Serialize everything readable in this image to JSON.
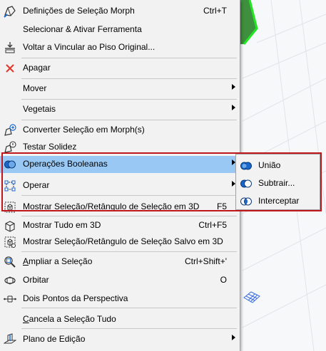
{
  "menu": {
    "items": [
      {
        "label": "Definições de Seleção Morph",
        "shortcut": "Ctrl+T",
        "icon": "morph-settings-icon"
      },
      {
        "label": "Selecionar & Ativar Ferramenta",
        "shortcut": "",
        "icon": ""
      },
      {
        "label": "Voltar a Vincular ao Piso Original...",
        "shortcut": "",
        "icon": "relink-floor-icon"
      },
      {
        "label": "Apagar",
        "shortcut": "",
        "icon": "delete-icon"
      },
      {
        "label": "Mover",
        "shortcut": "",
        "icon": ""
      },
      {
        "label": "Vegetais",
        "shortcut": "",
        "icon": ""
      },
      {
        "label": "Converter Seleção em Morph(s)",
        "shortcut": "",
        "icon": "convert-morph-icon"
      },
      {
        "label": "Testar Solidez",
        "shortcut": "",
        "icon": "test-solidity-icon"
      },
      {
        "label": "Operações Booleanas",
        "shortcut": "",
        "icon": "boolean-icon"
      },
      {
        "label": "Operar",
        "shortcut": "",
        "icon": "operate-icon"
      },
      {
        "label": "Mostrar Seleção/Retângulo de Seleção em 3D",
        "shortcut": "F5",
        "icon": "show-selection-3d-icon"
      },
      {
        "label": "Mostrar Tudo em 3D",
        "shortcut": "Ctrl+F5",
        "icon": "show-all-3d-icon"
      },
      {
        "label": "Mostrar Seleção/Retângulo de Seleção Salvo em 3D",
        "shortcut": "",
        "icon": "show-saved-selection-3d-icon"
      },
      {
        "label": "Ampliar a Seleção",
        "shortcut": "Ctrl+Shift+'",
        "icon": "zoom-selection-icon"
      },
      {
        "label": "Orbitar",
        "shortcut": "O",
        "icon": "orbit-icon"
      },
      {
        "label": "Dois Pontos da Perspectiva",
        "shortcut": "",
        "icon": "two-point-perspective-icon"
      },
      {
        "label": "Cancela a Seleção Tudo",
        "shortcut": "",
        "icon": ""
      },
      {
        "label": "Plano de Edição",
        "shortcut": "",
        "icon": "editing-plane-icon"
      }
    ]
  },
  "submenu": {
    "items": [
      {
        "label": "União",
        "icon": "union-icon"
      },
      {
        "label": "Subtrair...",
        "icon": "subtract-icon"
      },
      {
        "label": "Interceptar",
        "icon": "intersect-icon"
      }
    ]
  },
  "colors": {
    "highlight": "#99c8f5",
    "frame": "#c0161c",
    "menu_bg": "#f2f2f2",
    "accent_blue": "#1a66cc",
    "morph_green": "#22c322"
  }
}
